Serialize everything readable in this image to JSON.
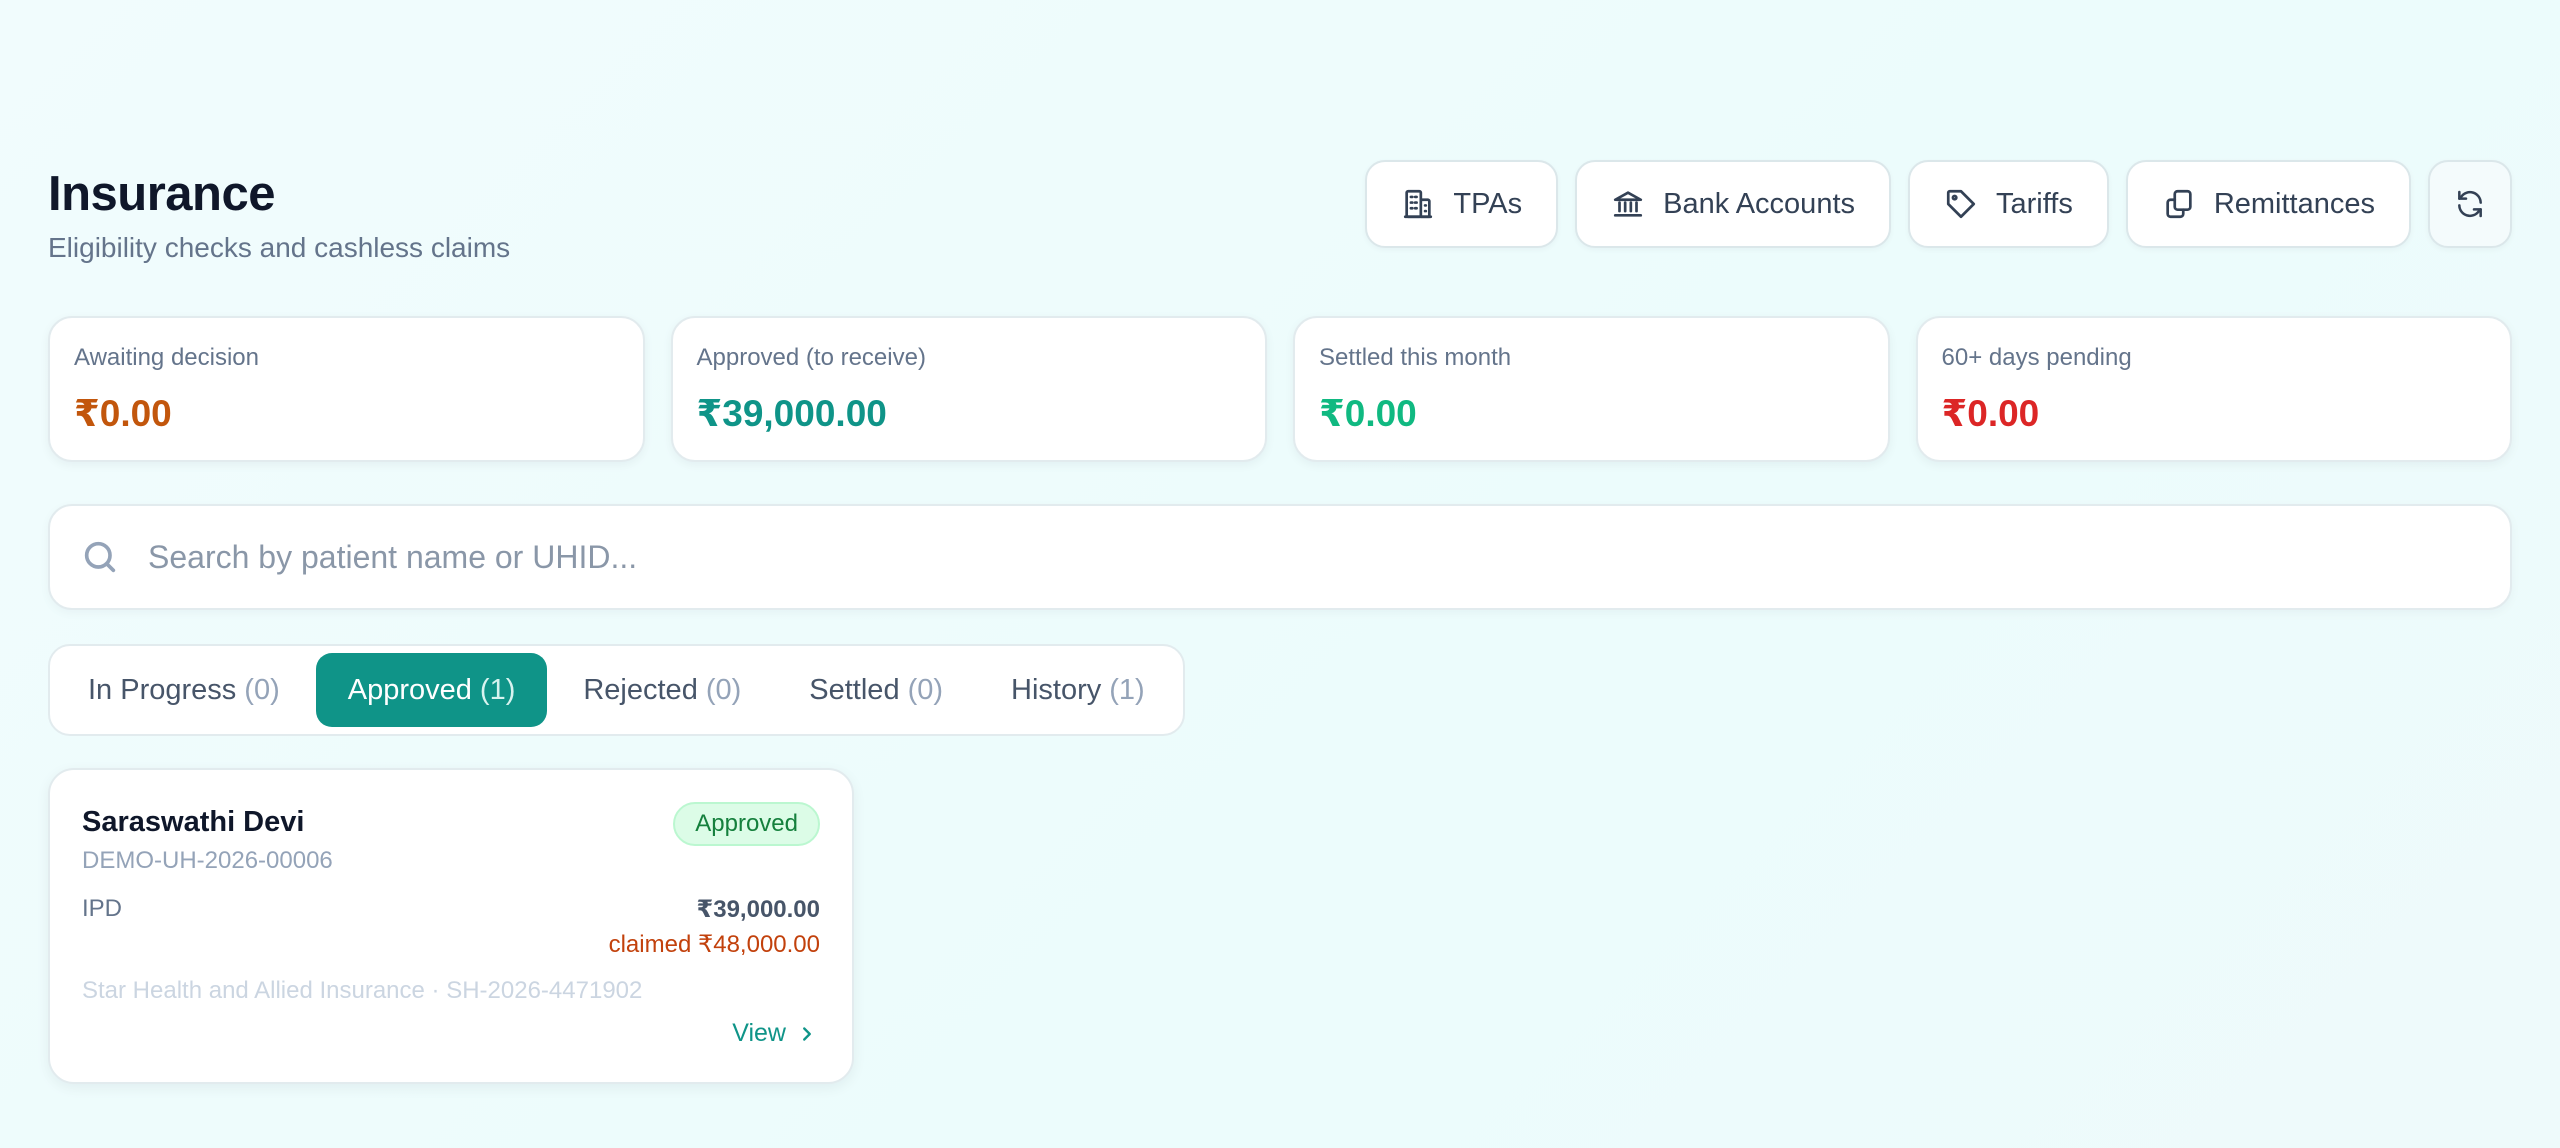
{
  "header": {
    "title": "Insurance",
    "subtitle": "Eligibility checks and cashless claims"
  },
  "toolbar": {
    "buttons": [
      {
        "label": "TPAs",
        "icon": "building-icon"
      },
      {
        "label": "Bank Accounts",
        "icon": "bank-icon"
      },
      {
        "label": "Tariffs",
        "icon": "tag-icon"
      },
      {
        "label": "Remittances",
        "icon": "copy-icon"
      }
    ],
    "refresh_icon": "refresh-icon"
  },
  "stats": [
    {
      "label": "Awaiting decision",
      "value": "₹0.00",
      "color": "#c2560c"
    },
    {
      "label": "Approved (to receive)",
      "value": "₹39,000.00",
      "color": "#0f9488"
    },
    {
      "label": "Settled this month",
      "value": "₹0.00",
      "color": "#10b981"
    },
    {
      "label": "60+ days pending",
      "value": "₹0.00",
      "color": "#dc2626"
    }
  ],
  "search": {
    "placeholder": "Search by patient name or UHID...",
    "value": ""
  },
  "tabs": [
    {
      "label": "In Progress",
      "count": "(0)",
      "active": false
    },
    {
      "label": "Approved",
      "count": "(1)",
      "active": true
    },
    {
      "label": "Rejected",
      "count": "(0)",
      "active": false
    },
    {
      "label": "Settled",
      "count": "(0)",
      "active": false
    },
    {
      "label": "History",
      "count": "(1)",
      "active": false
    }
  ],
  "claims": [
    {
      "patient_name": "Saraswathi Devi",
      "uhid": "DEMO-UH-2026-00006",
      "status": "Approved",
      "type": "IPD",
      "approved_amount": "₹39,000.00",
      "claimed": "claimed ₹48,000.00",
      "insurer_line": "Star Health and Allied Insurance · SH-2026-4471902",
      "action_label": "View"
    }
  ],
  "colors": {
    "accent": "#0f9488",
    "approved_badge_bg": "#dcfce7",
    "approved_badge_text": "#15803d",
    "claimed_text": "#c2410c"
  }
}
